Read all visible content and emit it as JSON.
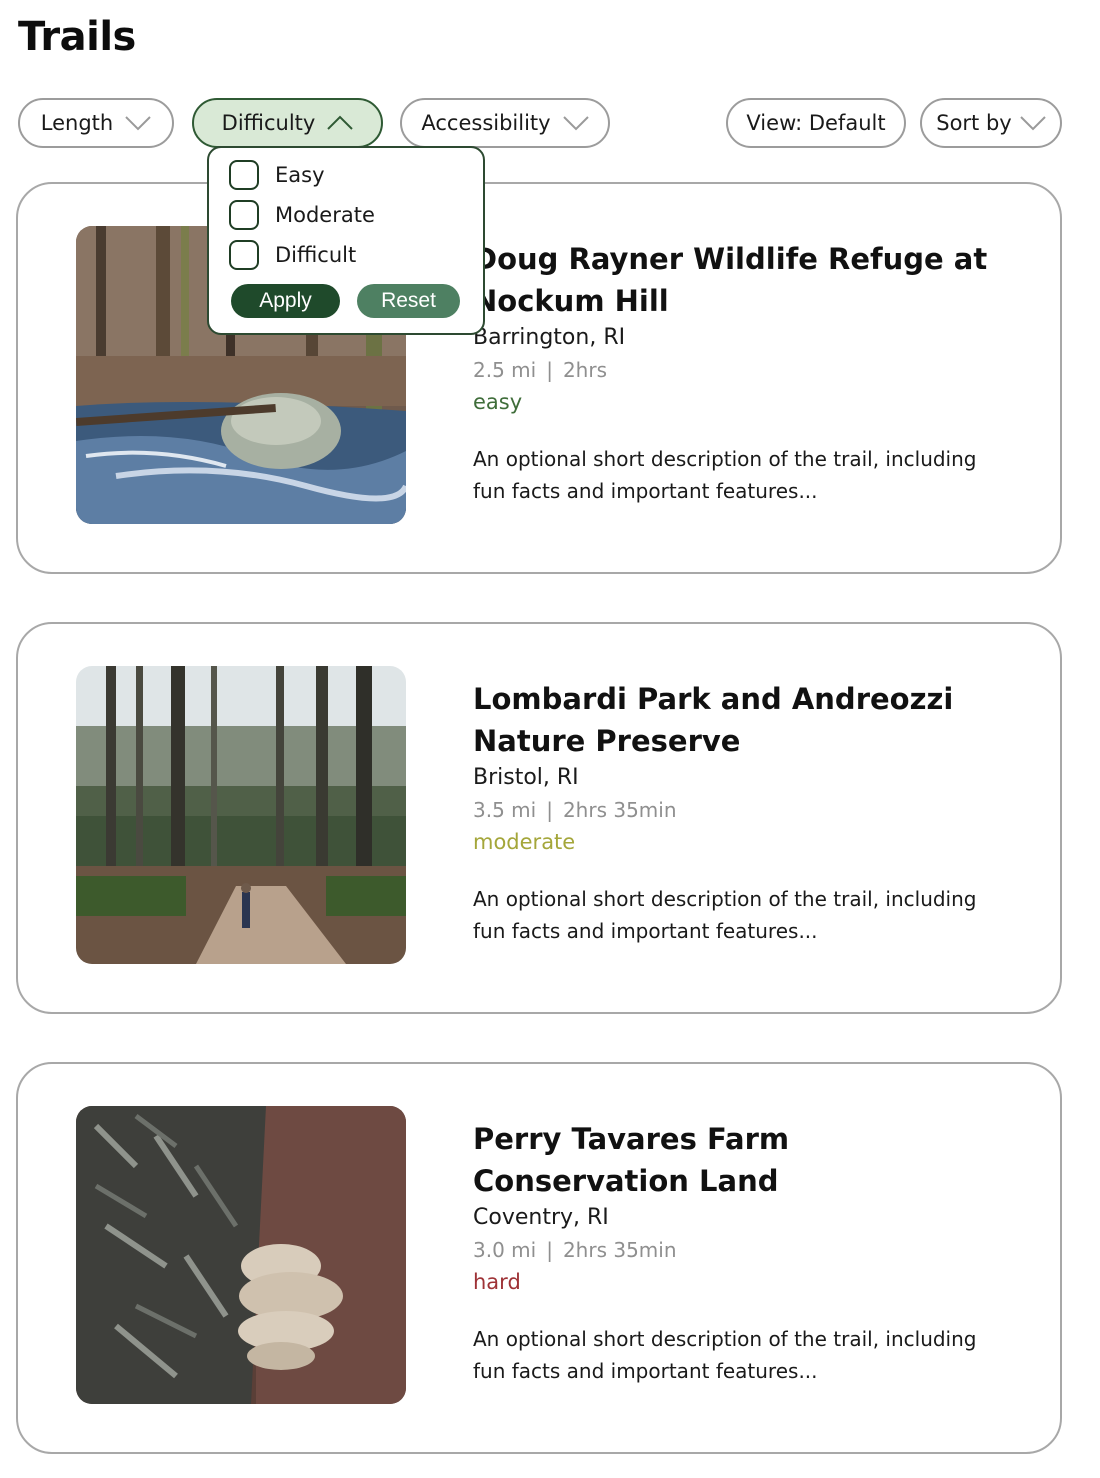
{
  "page": {
    "title": "Trails"
  },
  "filters": {
    "length": "Length",
    "difficulty": "Difficulty",
    "accessibility": "Accessibility",
    "view": "View: Default",
    "sort": "Sort by"
  },
  "difficulty_dropdown": {
    "options": [
      {
        "label": "Easy",
        "checked": false
      },
      {
        "label": "Moderate",
        "checked": false
      },
      {
        "label": "Difficult",
        "checked": false
      }
    ],
    "apply": "Apply",
    "reset": "Reset"
  },
  "trails": [
    {
      "name": "Doug Rayner Wildlife Refuge at Nockum Hill",
      "location": "Barrington, RI",
      "distance": "2.5 mi",
      "separator": "|",
      "duration": "2hrs",
      "difficulty": "easy",
      "difficulty_color": "#3f6d3a",
      "description": "An optional short description of the trail, including fun facts and important features...",
      "image": "stream-with-boulder"
    },
    {
      "name": "Lombardi Park and Andreozzi Nature Preserve",
      "location": "Bristol, RI",
      "distance": "3.5 mi",
      "separator": "|",
      "duration": "2hrs 35min",
      "difficulty": "moderate",
      "difficulty_color": "#a4a63a",
      "description": "An optional short description of the trail, including fun facts and important features...",
      "image": "pine-forest-path"
    },
    {
      "name": "Perry Tavares Farm Conservation Land",
      "location": "Coventry, RI",
      "distance": "3.0 mi",
      "separator": "|",
      "duration": "2hrs 35min",
      "difficulty": "hard",
      "difficulty_color": "#9e3236",
      "description": "An optional short description of the trail, including fun facts and important features...",
      "image": "tree-fungus"
    }
  ]
}
